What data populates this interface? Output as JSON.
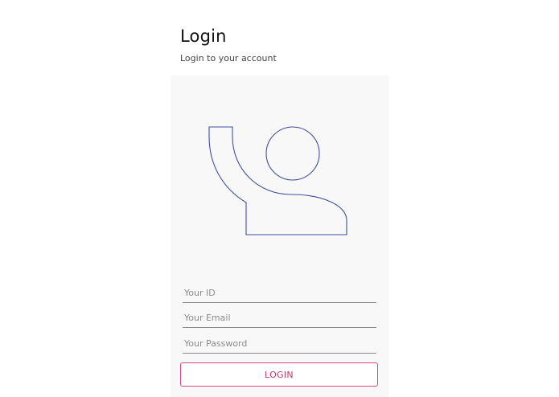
{
  "header": {
    "title": "Login",
    "subtitle": "Login to your account"
  },
  "illustration": {
    "icon": "user-waving-icon",
    "stroke_color": "#3f51a3"
  },
  "form": {
    "id_placeholder": "Your ID",
    "email_placeholder": "Your Email",
    "password_placeholder": "Your Password",
    "id_value": "",
    "email_value": "",
    "password_value": ""
  },
  "login_button": {
    "label": "LOGIN",
    "accent_color": "#d6487e"
  }
}
